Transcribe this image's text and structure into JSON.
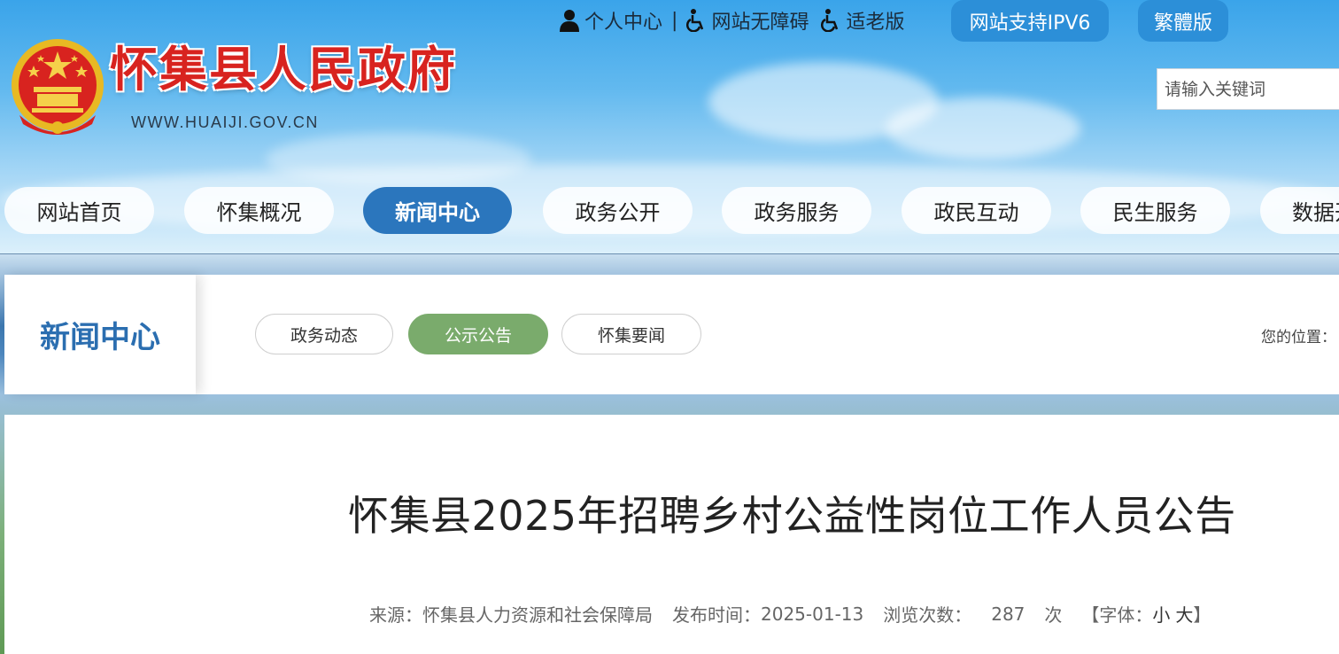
{
  "header": {
    "site_title": "怀集县人民政府",
    "site_url": "WWW.HUAIJI.GOV.CN",
    "top_links": {
      "personal_center": "个人中心",
      "separator": "|",
      "accessibility": "网站无障碍",
      "elderly": "适老版"
    },
    "ipv6_button": "网站支持IPV6",
    "traditional_button": "繁體版",
    "search": {
      "placeholder": "请输入关键词",
      "value": ""
    }
  },
  "nav": {
    "items": [
      {
        "label": "网站首页",
        "active": false
      },
      {
        "label": "怀集概况",
        "active": false
      },
      {
        "label": "新闻中心",
        "active": true
      },
      {
        "label": "政务公开",
        "active": false
      },
      {
        "label": "政务服务",
        "active": false
      },
      {
        "label": "政民互动",
        "active": false
      },
      {
        "label": "民生服务",
        "active": false
      },
      {
        "label": "数据开",
        "active": false
      }
    ]
  },
  "section": {
    "title": "新闻中心",
    "tabs": [
      {
        "label": "政务动态",
        "active": false
      },
      {
        "label": "公示公告",
        "active": true
      },
      {
        "label": "怀集要闻",
        "active": false
      }
    ],
    "location_label": "您的位置："
  },
  "article": {
    "title": "怀集县2025年招聘乡村公益性岗位工作人员公告",
    "source_label": "来源：",
    "source": "怀集县人力资源和社会保障局",
    "date_label": "发布时间：",
    "date": "2025-01-13",
    "views_label": "浏览次数：",
    "views": "287",
    "views_unit": "次",
    "font_label": "【字体：",
    "font_small": "小",
    "font_large": "大",
    "font_close": "】"
  },
  "colors": {
    "nav_active": "#2b76bd",
    "tab_active": "#7aab6c",
    "title_red": "#d8231f",
    "button_blue": "#2c8fd8"
  },
  "icons": [
    "person-icon",
    "wheelchair-icon",
    "elderly-icon",
    "national-emblem-icon"
  ]
}
